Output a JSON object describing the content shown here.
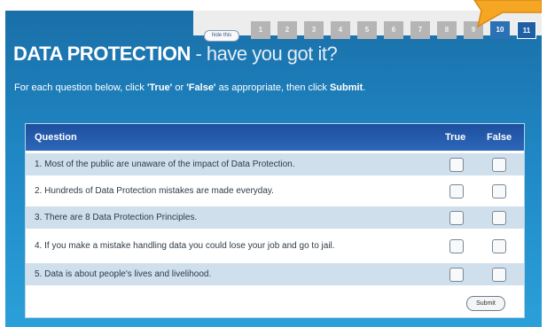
{
  "nav": {
    "hide_label": "hide this",
    "pages": [
      "1",
      "2",
      "3",
      "4",
      "5",
      "6",
      "7",
      "8",
      "9",
      "10",
      "11"
    ],
    "current_page": "11"
  },
  "header": {
    "title_main": "DATA PROTECTION",
    "title_sub": " - have you got it?"
  },
  "instructions": {
    "part1": "For each question below, click ",
    "true_word": "'True'",
    "part2": " or ",
    "false_word": "'False'",
    "part3": " as appropriate, then click ",
    "submit_word": "Submit",
    "part4": "."
  },
  "quiz": {
    "col_question": "Question",
    "col_true": "True",
    "col_false": "False",
    "questions": [
      "1. Most of the public are unaware of the impact of Data Protection.",
      "2. Hundreds of Data Protection mistakes are made everyday.",
      "3. There are 8 Data Protection Principles.",
      "4. If you make a mistake handling data you could lose your job and go to jail.",
      "5. Data is about people's lives and livelihood."
    ],
    "submit_label": "Submit"
  },
  "colors": {
    "panel_blue": "#1f87c4",
    "header_blue": "#1d4f9e",
    "row_tint": "#cfdfec",
    "arrow_orange": "#f5a623"
  }
}
